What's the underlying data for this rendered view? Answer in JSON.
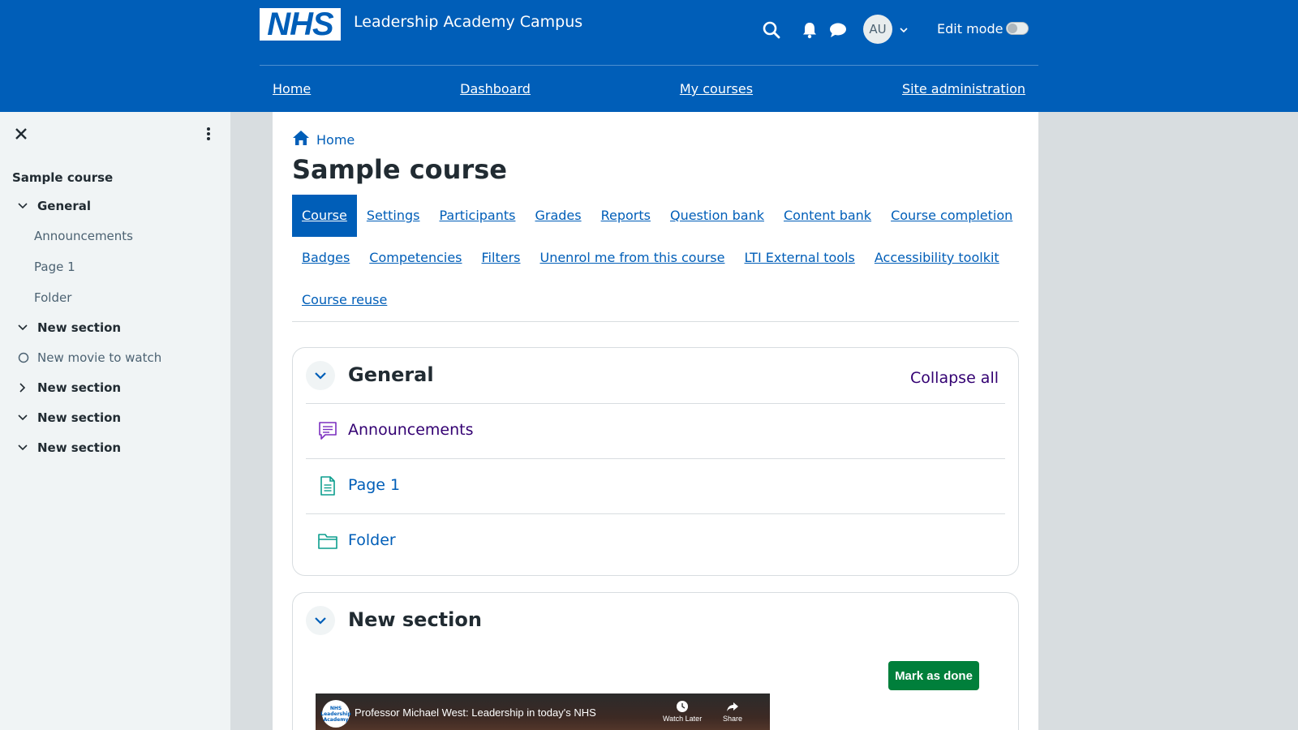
{
  "header": {
    "logo_text": "NHS",
    "site_name": "Leadership Academy Campus",
    "avatar_initials": "AU",
    "edit_mode_label": "Edit mode",
    "icons": [
      "search-icon",
      "bell-icon",
      "chat-icon",
      "chevron-down-icon"
    ],
    "nav": [
      {
        "label": "Home"
      },
      {
        "label": "Dashboard"
      },
      {
        "label": "My courses"
      },
      {
        "label": "Site administration"
      }
    ]
  },
  "drawer": {
    "course_title": "Sample course",
    "items": [
      {
        "label": "General",
        "type": "section",
        "state": "expanded"
      },
      {
        "label": "Announcements",
        "type": "activity"
      },
      {
        "label": "Page 1",
        "type": "activity"
      },
      {
        "label": "Folder",
        "type": "activity"
      },
      {
        "label": "New section",
        "type": "section",
        "state": "expanded"
      },
      {
        "label": "New movie to watch",
        "type": "activity-incomplete"
      },
      {
        "label": "New section",
        "type": "section",
        "state": "collapsed"
      },
      {
        "label": "New section",
        "type": "section",
        "state": "expanded"
      },
      {
        "label": "New section",
        "type": "section",
        "state": "expanded"
      }
    ]
  },
  "main": {
    "breadcrumb_home": "Home",
    "page_title": "Sample course",
    "secondary_nav_row1": [
      "Course",
      "Settings",
      "Participants",
      "Grades",
      "Reports",
      "Question bank",
      "Content bank",
      "Course completion"
    ],
    "secondary_nav_row2": [
      "Badges",
      "Competencies",
      "Filters",
      "Unenrol me from this course",
      "LTI External tools",
      "Accessibility toolkit"
    ],
    "secondary_nav_row3": [
      "Course reuse"
    ],
    "active_tab": "Course",
    "sections": [
      {
        "title": "General",
        "collapse_all": "Collapse all",
        "activities": [
          {
            "name": "Announcements",
            "icon": "forum-icon",
            "color": "#330072"
          },
          {
            "name": "Page 1",
            "icon": "page-icon",
            "color": "#005eb8"
          },
          {
            "name": "Folder",
            "icon": "folder-icon",
            "color": "#005eb8"
          }
        ]
      },
      {
        "title": "New section",
        "mark_done_label": "Mark as done",
        "video": {
          "title": "Professor Michael West: Leadership in today's NHS",
          "logo_text": "NHS Leadership Academy",
          "watch_later": "Watch Later",
          "share": "Share"
        }
      }
    ]
  },
  "colors": {
    "brand_blue": "#005eb8",
    "link_purple": "#330072",
    "success_green": "#007f3b",
    "drawer_bg": "#f0f4f5",
    "page_bg": "#d8dde0"
  }
}
